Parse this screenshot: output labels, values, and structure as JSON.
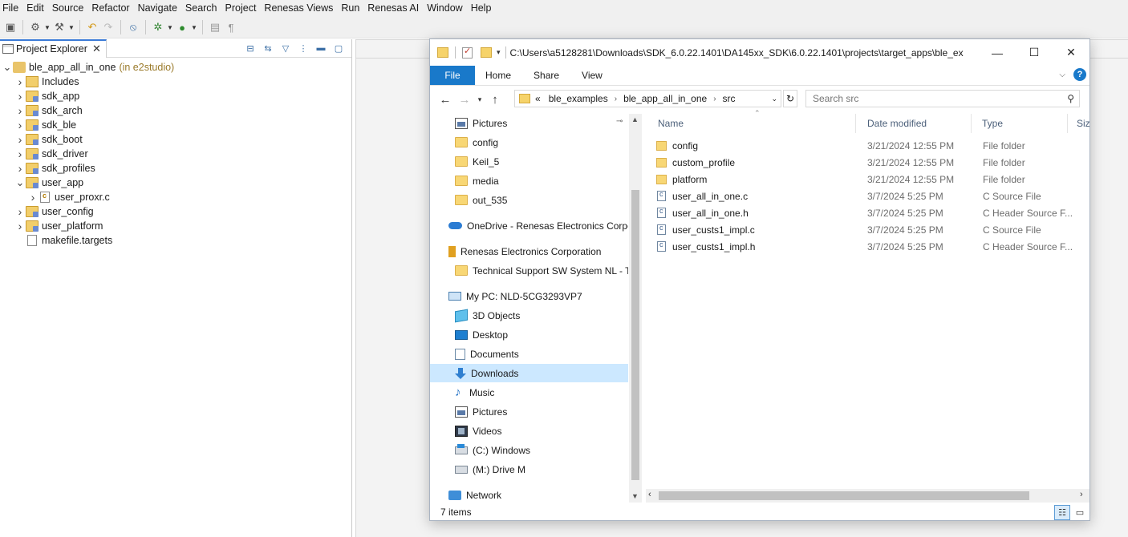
{
  "menubar": [
    "File",
    "Edit",
    "Source",
    "Refactor",
    "Navigate",
    "Search",
    "Project",
    "Renesas Views",
    "Run",
    "Renesas AI",
    "Window",
    "Help"
  ],
  "project_explorer": {
    "tab_label": "Project Explorer",
    "tree": [
      {
        "label": "ble_app_all_in_one",
        "annotation": "(in e2studio)",
        "twisty": "expanded",
        "icon": "project-icon",
        "depth": 0
      },
      {
        "label": "Includes",
        "twisty": "collapsed",
        "icon": "includes-icon",
        "depth": 1
      },
      {
        "label": "sdk_app",
        "twisty": "collapsed",
        "icon": "folder-icon",
        "depth": 1
      },
      {
        "label": "sdk_arch",
        "twisty": "collapsed",
        "icon": "folder-icon",
        "depth": 1
      },
      {
        "label": "sdk_ble",
        "twisty": "collapsed",
        "icon": "folder-icon",
        "depth": 1
      },
      {
        "label": "sdk_boot",
        "twisty": "collapsed",
        "icon": "folder-icon",
        "depth": 1
      },
      {
        "label": "sdk_driver",
        "twisty": "collapsed",
        "icon": "folder-icon",
        "depth": 1
      },
      {
        "label": "sdk_profiles",
        "twisty": "collapsed",
        "icon": "folder-icon",
        "depth": 1
      },
      {
        "label": "user_app",
        "twisty": "expanded",
        "icon": "folder-icon",
        "depth": 1
      },
      {
        "label": "user_proxr.c",
        "twisty": "collapsed",
        "icon": "c-file-icon",
        "depth": 2
      },
      {
        "label": "user_config",
        "twisty": "collapsed",
        "icon": "folder-icon",
        "depth": 1
      },
      {
        "label": "user_platform",
        "twisty": "collapsed",
        "icon": "folder-icon",
        "depth": 1
      },
      {
        "label": "makefile.targets",
        "twisty": "none",
        "icon": "file-icon",
        "depth": 1
      }
    ]
  },
  "explorer": {
    "path": "C:\\Users\\a5128281\\Downloads\\SDK_6.0.22.1401\\DA145xx_SDK\\6.0.22.1401\\projects\\target_apps\\ble_ex",
    "window_buttons": {
      "minimize": "—",
      "maximize": "☐",
      "close": "✕"
    },
    "ribbon": {
      "file": "File",
      "tabs": [
        "Home",
        "Share",
        "View"
      ],
      "help": "?"
    },
    "breadcrumb": [
      "«",
      "ble_examples",
      "ble_app_all_in_one",
      "src"
    ],
    "search": {
      "placeholder": "Search src",
      "value": ""
    },
    "nav_pane": [
      {
        "label": "Pictures",
        "icon": "pictures-icon",
        "level": 1,
        "pinned": true
      },
      {
        "label": "config",
        "icon": "folder-icon",
        "level": 1
      },
      {
        "label": "Keil_5",
        "icon": "folder-icon",
        "level": 1
      },
      {
        "label": "media",
        "icon": "folder-icon",
        "level": 1
      },
      {
        "label": "out_535",
        "icon": "folder-icon",
        "level": 1
      },
      {
        "label": "OneDrive - Renesas Electronics Corporation",
        "icon": "onedrive-icon",
        "level": 0
      },
      {
        "label": "Renesas Electronics Corporation",
        "icon": "corp-icon",
        "level": 0
      },
      {
        "label": "Technical Support SW System NL - Te",
        "icon": "folder-icon",
        "level": 1
      },
      {
        "label": "My PC: NLD-5CG3293VP7",
        "icon": "pc-icon",
        "level": 0
      },
      {
        "label": "3D Objects",
        "icon": "3d-objects-icon",
        "level": 1
      },
      {
        "label": "Desktop",
        "icon": "desktop-icon",
        "level": 1
      },
      {
        "label": "Documents",
        "icon": "documents-icon",
        "level": 1
      },
      {
        "label": "Downloads",
        "icon": "downloads-icon",
        "level": 1,
        "selected": true
      },
      {
        "label": "Music",
        "icon": "music-icon",
        "level": 1
      },
      {
        "label": "Pictures",
        "icon": "pictures-icon",
        "level": 1
      },
      {
        "label": "Videos",
        "icon": "videos-icon",
        "level": 1
      },
      {
        "label": "(C:) Windows",
        "icon": "drive-c-icon",
        "level": 1
      },
      {
        "label": "(M:) Drive M",
        "icon": "drive-m-icon",
        "level": 1
      },
      {
        "label": "Network",
        "icon": "network-icon",
        "level": 0
      }
    ],
    "columns": [
      "Name",
      "Date modified",
      "Type",
      "Size"
    ],
    "files": [
      {
        "name": "config",
        "date": "3/21/2024 12:55 PM",
        "type": "File folder",
        "icon": "folder-icon"
      },
      {
        "name": "custom_profile",
        "date": "3/21/2024 12:55 PM",
        "type": "File folder",
        "icon": "folder-icon"
      },
      {
        "name": "platform",
        "date": "3/21/2024 12:55 PM",
        "type": "File folder",
        "icon": "folder-icon"
      },
      {
        "name": "user_all_in_one.c",
        "date": "3/7/2024 5:25 PM",
        "type": "C Source File",
        "icon": "c-file-icon"
      },
      {
        "name": "user_all_in_one.h",
        "date": "3/7/2024 5:25 PM",
        "type": "C Header Source F...",
        "icon": "c-file-icon"
      },
      {
        "name": "user_custs1_impl.c",
        "date": "3/7/2024 5:25 PM",
        "type": "C Source File",
        "icon": "c-file-icon"
      },
      {
        "name": "user_custs1_impl.h",
        "date": "3/7/2024 5:25 PM",
        "type": "C Header Source F...",
        "icon": "c-file-icon"
      }
    ],
    "status": "7 items"
  }
}
